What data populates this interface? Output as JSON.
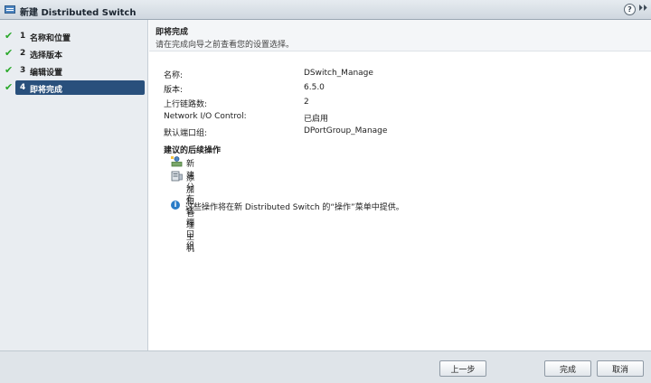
{
  "window": {
    "title": "新建 Distributed Switch",
    "help_glyph": "?",
    "expand_glyph": "⏵⏵"
  },
  "steps": [
    {
      "num": "1",
      "label": "名称和位置",
      "check": "✔"
    },
    {
      "num": "2",
      "label": "选择版本",
      "check": "✔"
    },
    {
      "num": "3",
      "label": "编辑设置",
      "check": "✔"
    },
    {
      "num": "4",
      "label": "即将完成",
      "check": "✔"
    }
  ],
  "content": {
    "title": "即将完成",
    "subtitle": "请在完成向导之前查看您的设置选择。",
    "summary": [
      {
        "label": "名称:",
        "value": "DSwitch_Manage"
      },
      {
        "label": "版本:",
        "value": "6.5.0"
      },
      {
        "label": "上行链路数:",
        "value": "2"
      },
      {
        "label": "Network I/O Control:",
        "value": "已启用"
      },
      {
        "label": "默认端口组:",
        "value": "DPortGroup_Manage"
      }
    ],
    "next_steps_title": "建议的后续操作",
    "next_steps": [
      {
        "label": "新建分布式端口组"
      },
      {
        "label": "添加和管理主机"
      }
    ],
    "info": "这些操作将在新 Distributed Switch 的“操作”菜单中提供。",
    "info_glyph": "i"
  },
  "footer": {
    "back": "上一步",
    "finish": "完成",
    "cancel": "取消"
  },
  "colors": {
    "active_step": "#29507c",
    "check": "#29a829",
    "info": "#2a7cc7"
  }
}
